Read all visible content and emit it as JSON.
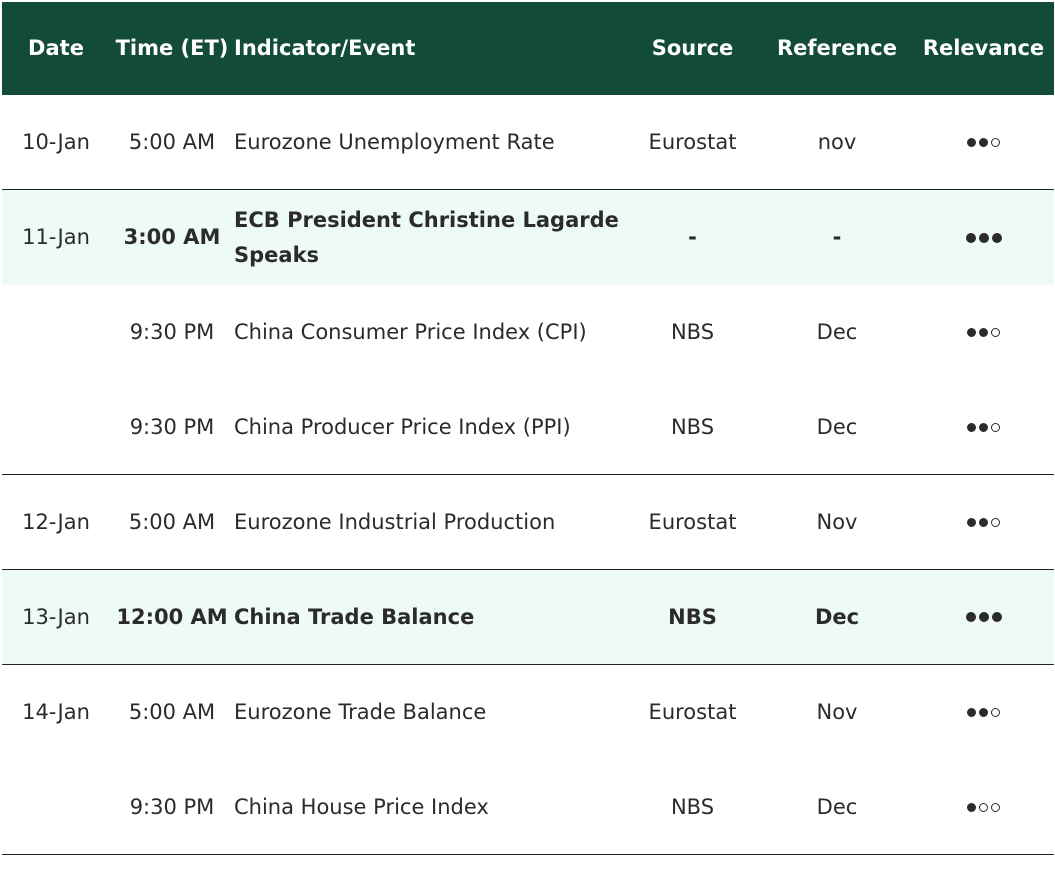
{
  "header": {
    "date": "Date",
    "time": "Time (ET)",
    "event": "Indicator/Event",
    "source": "Source",
    "reference": "Reference",
    "relevance": "Relevance"
  },
  "rows": [
    {
      "date": "10-Jan",
      "time": "5:00 AM",
      "event": "Eurozone Unemployment Rate",
      "source": "Eurostat",
      "reference": "nov",
      "relevance": 2
    },
    {
      "date": "11-Jan",
      "time": "3:00 AM",
      "event": "ECB President Christine Lagarde Speaks",
      "source": "-",
      "reference": "-",
      "relevance": 3
    },
    {
      "date": "",
      "time": "9:30 PM",
      "event": "China Consumer Price Index (CPI)",
      "source": "NBS",
      "reference": "Dec",
      "relevance": 2
    },
    {
      "date": "",
      "time": "9:30 PM",
      "event": "China Producer Price Index (PPI)",
      "source": "NBS",
      "reference": "Dec",
      "relevance": 2
    },
    {
      "date": "12-Jan",
      "time": "5:00 AM",
      "event": "Eurozone Industrial Production",
      "source": "Eurostat",
      "reference": "Nov",
      "relevance": 2
    },
    {
      "date": "13-Jan",
      "time": "12:00 AM",
      "event": "China Trade Balance",
      "source": "NBS",
      "reference": "Dec",
      "relevance": 3
    },
    {
      "date": "14-Jan",
      "time": "5:00 AM",
      "event": "Eurozone Trade Balance",
      "source": "Eurostat",
      "reference": "Nov",
      "relevance": 2
    },
    {
      "date": "",
      "time": "9:30 PM",
      "event": "China House Price Index",
      "source": "NBS",
      "reference": "Dec",
      "relevance": 1
    }
  ],
  "relevance_max": 3,
  "colors": {
    "header_bg": "#124b37",
    "highlight_bg": "#eefaf5",
    "text": "#2b2b2b"
  }
}
